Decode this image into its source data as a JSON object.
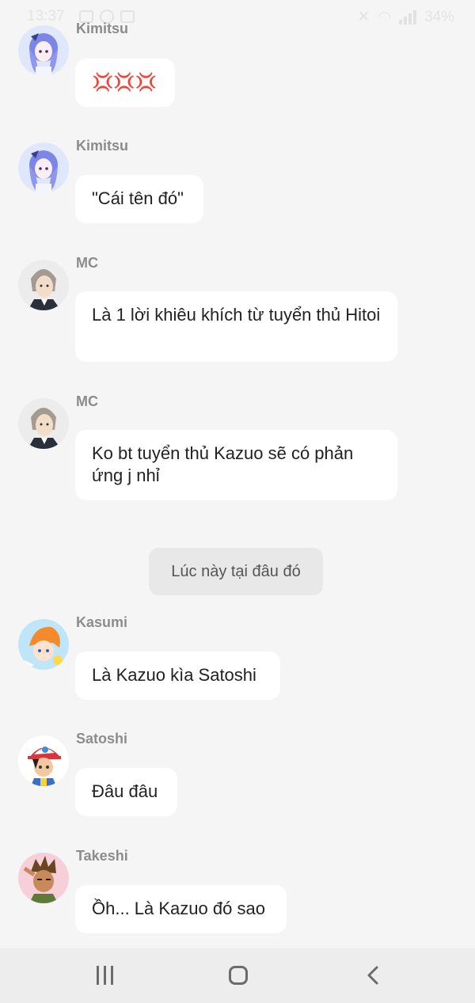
{
  "status_bar": {
    "time": "13:37",
    "battery": "34%"
  },
  "messages": [
    {
      "sender": "Kimitsu",
      "text": "💢💢💢",
      "avatar_icon": "kimitsu-avatar"
    },
    {
      "sender": "Kimitsu",
      "text": "\"Cái tên đó\"",
      "avatar_icon": "kimitsu-avatar"
    },
    {
      "sender": "MC",
      "text": "Là 1 lời khiêu khích từ tuyển thủ Hitoi",
      "avatar_icon": "mc-avatar"
    },
    {
      "sender": "MC",
      "text": "Ko bt tuyển thủ Kazuo sẽ có phản ứng j nhỉ",
      "avatar_icon": "mc-avatar"
    },
    {
      "sender": "Kasumi",
      "text": "Là Kazuo kìa Satoshi",
      "avatar_icon": "kasumi-avatar"
    },
    {
      "sender": "Satoshi",
      "text": "Đâu đâu",
      "avatar_icon": "satoshi-avatar"
    },
    {
      "sender": "Takeshi",
      "text": "Ồh... Là Kazuo đó sao",
      "avatar_icon": "takeshi-avatar"
    }
  ],
  "narration": "Lúc này tại đâu đó",
  "colors": {
    "background": "#f5f5f5",
    "bubble": "#ffffff",
    "narration_bg": "#e8e8e8",
    "sender_text": "#8c8c8c"
  }
}
